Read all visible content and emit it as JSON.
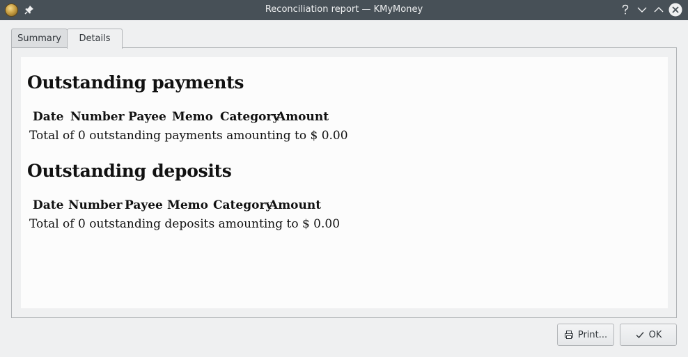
{
  "window": {
    "title": "Reconciliation report — KMyMoney",
    "controls": [
      "help-icon",
      "minimize-icon",
      "maximize-icon",
      "close-icon"
    ]
  },
  "tabs": [
    {
      "label": "Summary",
      "active": false
    },
    {
      "label": "Details",
      "active": true
    }
  ],
  "report": {
    "payments": {
      "heading": "Outstanding payments",
      "columns": [
        "Date",
        "Number",
        "Payee",
        "Memo",
        "Category",
        "Amount"
      ],
      "summary": "Total of 0 outstanding payments amounting to $ 0.00"
    },
    "deposits": {
      "heading": "Outstanding deposits",
      "columns": [
        "Date",
        "Number",
        "Payee",
        "Memo",
        "Category",
        "Amount"
      ],
      "summary": "Total of 0 outstanding deposits amounting to $ 0.00"
    }
  },
  "buttons": {
    "print_label": "Print...",
    "ok_label": "OK"
  },
  "colors": {
    "titlebar": "#475057",
    "window_bg": "#eff0f1",
    "report_bg": "#fcfcfc"
  }
}
